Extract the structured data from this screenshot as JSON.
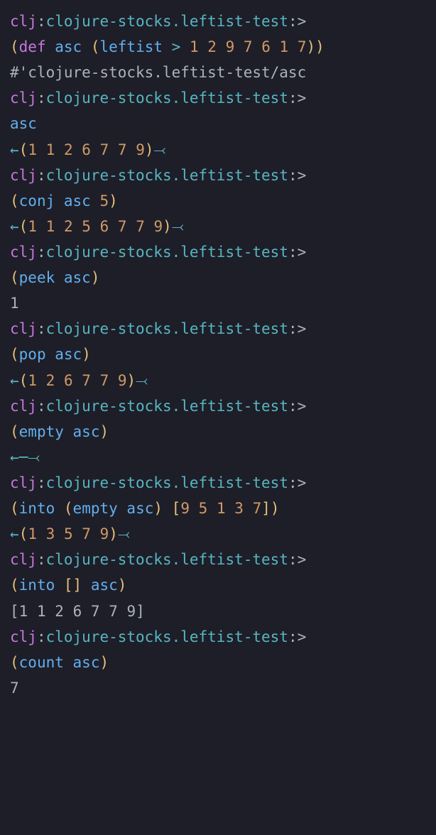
{
  "prompt": {
    "clj": "clj",
    "colon": ":",
    "ns": "clojure-stocks.leftist-test",
    "gt": ">"
  },
  "lines": {
    "def_line": {
      "def": "def",
      "name": "asc",
      "fn": "leftist",
      "op": ">",
      "args": [
        "1",
        "2",
        "9",
        "7",
        "6",
        "1",
        "7"
      ]
    },
    "var_out": "#'clojure-stocks.leftist-test/asc",
    "eval_asc": "asc",
    "out_asc": {
      "left": "←",
      "nums": [
        "1",
        "1",
        "2",
        "6",
        "7",
        "7",
        "9"
      ],
      "right": "⤙"
    },
    "conj": {
      "fn": "conj",
      "arg1": "asc",
      "arg2": "5"
    },
    "out_conj": {
      "left": "←",
      "nums": [
        "1",
        "1",
        "2",
        "5",
        "6",
        "7",
        "7",
        "9"
      ],
      "right": "⤙"
    },
    "peek": {
      "fn": "peek",
      "arg1": "asc"
    },
    "out_peek": "1",
    "pop": {
      "fn": "pop",
      "arg1": "asc"
    },
    "out_pop": {
      "left": "←",
      "nums": [
        "1",
        "2",
        "6",
        "7",
        "7",
        "9"
      ],
      "right": "⤙"
    },
    "empty": {
      "fn": "empty",
      "arg1": "asc"
    },
    "out_empty": {
      "left": "←─",
      "right": "⤙"
    },
    "into1": {
      "fn": "into",
      "inner_fn": "empty",
      "inner_arg": "asc",
      "vec": [
        "9",
        "5",
        "1",
        "3",
        "7"
      ]
    },
    "out_into1": {
      "left": "←",
      "nums": [
        "1",
        "3",
        "5",
        "7",
        "9"
      ],
      "right": "⤙"
    },
    "into2": {
      "fn": "into",
      "vec_empty": "[]",
      "arg": "asc"
    },
    "out_into2": [
      "1",
      "1",
      "2",
      "6",
      "7",
      "7",
      "9"
    ],
    "count": {
      "fn": "count",
      "arg1": "asc"
    },
    "out_count": "7"
  }
}
